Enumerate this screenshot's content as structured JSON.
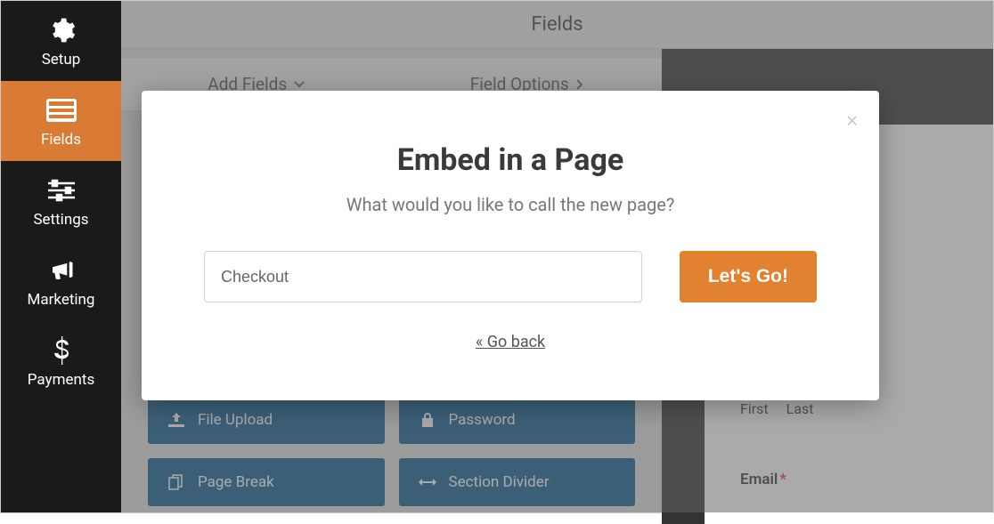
{
  "sidebar": {
    "items": [
      {
        "label": "Setup"
      },
      {
        "label": "Fields"
      },
      {
        "label": "Settings"
      },
      {
        "label": "Marketing"
      },
      {
        "label": "Payments"
      }
    ]
  },
  "header": {
    "title": "Fields"
  },
  "tabs": {
    "add": "Add Fields",
    "options": "Field Options"
  },
  "fields": {
    "file_upload": "File Upload",
    "password": "Password",
    "page_break": "Page Break",
    "section_divider": "Section Divider"
  },
  "preview": {
    "first": "First",
    "last": "Last",
    "email": "Email",
    "req": "*"
  },
  "modal": {
    "title": "Embed in a Page",
    "subtitle": "What would you like to call the new page?",
    "input_value": "Checkout",
    "button": "Let's Go!",
    "back": "« Go back",
    "close": "×"
  }
}
